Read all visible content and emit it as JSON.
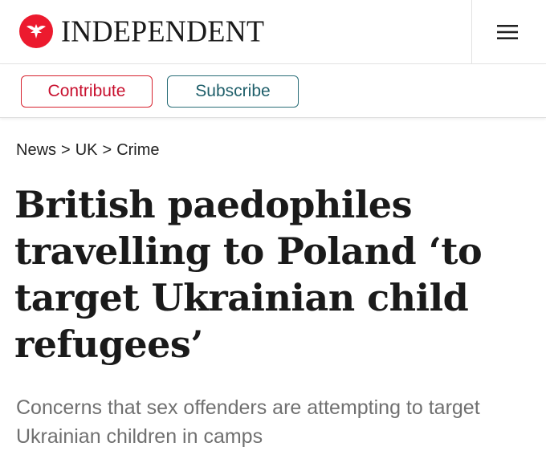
{
  "header": {
    "logo_text": "INDEPENDENT",
    "logo_icon": "eagle-icon",
    "menu_icon": "hamburger-menu-icon"
  },
  "actions": {
    "contribute_label": "Contribute",
    "subscribe_label": "Subscribe"
  },
  "breadcrumb": {
    "items": [
      "News",
      "UK",
      "Crime"
    ],
    "separator": ">"
  },
  "article": {
    "headline": "British paedophiles travelling to Poland ‘to target Ukrainian child refugees’",
    "standfirst": "Concerns that sex offenders are attempting to target Ukrainian children in camps"
  },
  "colors": {
    "brand_red": "#ec1a2e",
    "contribute": "#c8102e",
    "subscribe": "#1f5f6a"
  }
}
